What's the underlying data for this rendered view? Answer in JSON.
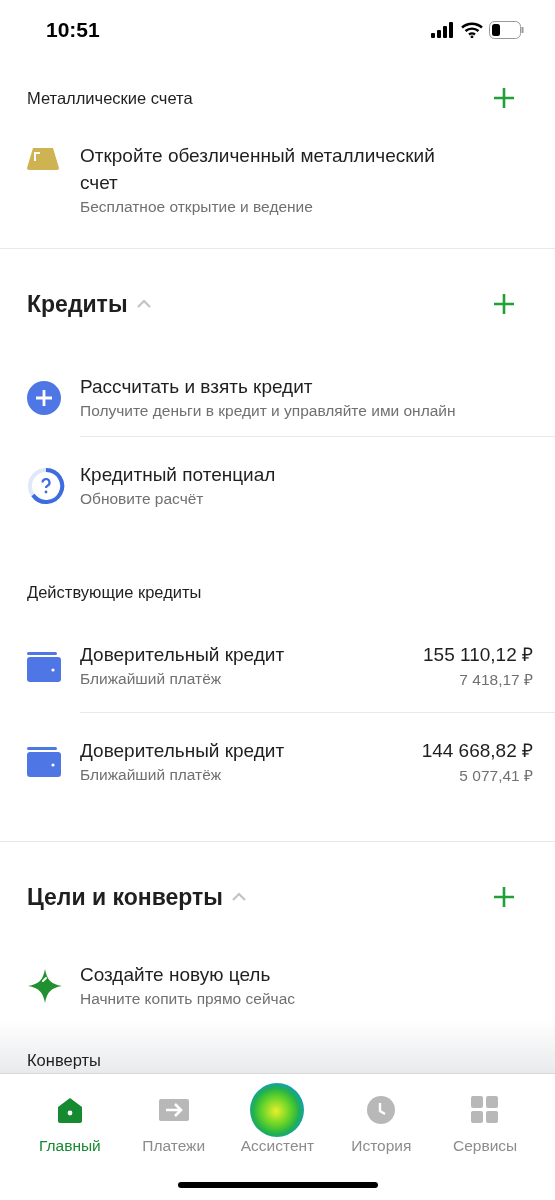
{
  "status_bar": {
    "time": "10:51"
  },
  "metal": {
    "title": "Металлические счета",
    "items": [
      {
        "kind": "gold-bar",
        "title": "Откройте обезличенный металлический счет",
        "subtitle": "Бесплатное открытие и ведение"
      }
    ]
  },
  "credits": {
    "title": "Кредиты",
    "expanded": true,
    "actions": [
      {
        "kind": "plus-circle",
        "title": "Рассчитать и взять кредит",
        "subtitle": "Получите деньги в кредит и управляйте ими онлайн"
      },
      {
        "kind": "potential",
        "title": "Кредитный потенциал",
        "subtitle": "Обновите расчёт"
      }
    ],
    "active_title": "Действующие кредиты",
    "loans": [
      {
        "title": "Доверительный кредит",
        "subtitle": "Ближайший платёж",
        "amount": "155 110,12 ₽",
        "payment": "7 418,17 ₽"
      },
      {
        "title": "Доверительный кредит",
        "subtitle": "Ближайший платёж",
        "amount": "144 668,82 ₽",
        "payment": "5 077,41 ₽"
      }
    ]
  },
  "goals": {
    "title": "Цели и конверты",
    "expanded": true,
    "items": [
      {
        "kind": "star",
        "title": "Создайте новую цель",
        "subtitle": "Начните копить прямо сейчас"
      }
    ],
    "next_title": "Конверты"
  },
  "tabs": [
    {
      "kind": "home",
      "label": "Главный",
      "selected": true
    },
    {
      "kind": "arrow",
      "label": "Платежи",
      "selected": false
    },
    {
      "kind": "assistant",
      "label": "Ассистент",
      "selected": false
    },
    {
      "kind": "clock",
      "label": "История",
      "selected": false
    },
    {
      "kind": "grid",
      "label": "Сервисы",
      "selected": false
    }
  ]
}
